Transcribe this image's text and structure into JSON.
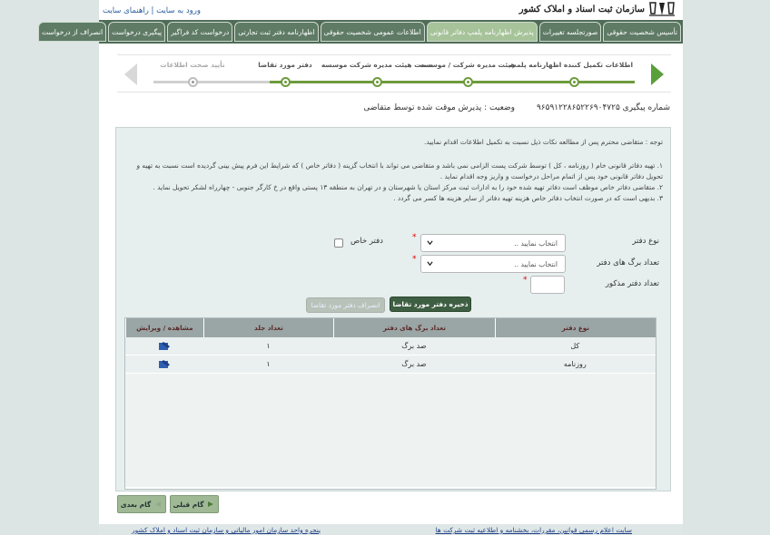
{
  "header": {
    "site_links": [
      "ورود به سایت",
      "راهنمای سایت"
    ],
    "logo_text": "سازمان ثبت اسناد و املاک کشور"
  },
  "tabs": [
    {
      "label": "تأسیس شخصیت حقوقی",
      "active": false
    },
    {
      "label": "صورتجلسه تغییرات",
      "active": false
    },
    {
      "label": "پذیرش اظهارنامه پلمپ دفاتر قانونی",
      "active": true
    },
    {
      "label": "اطلاعات عمومی شخصیت حقوقی",
      "active": false
    },
    {
      "label": "اظهارنامه دفتر ثبت تجارتی",
      "active": false
    },
    {
      "label": "درخواست کد فراگیر",
      "active": false
    },
    {
      "label": "پیگیری درخواست",
      "active": false
    },
    {
      "label": "انصراف از درخواست",
      "active": false
    }
  ],
  "wizard": {
    "steps": [
      {
        "label": "اطلاعات تکمیل کننده اظهارنامه پلمپ",
        "done": true
      },
      {
        "label": "هیئت مدیره شرکت / موسسه",
        "done": true
      },
      {
        "label": "سمت هیئت مدیره شرکت موسسه",
        "done": true
      },
      {
        "label": "دفتر مورد تقاضا",
        "done": true
      },
      {
        "label": "تأیید صحت اطلاعات",
        "done": false
      }
    ]
  },
  "status": {
    "tracking": "شماره پیگیری ۹۶۵۹۱۲۲۸۶۵۲۲۶۹۰۴۷۲۵",
    "state": "وضعیت : پذیرش موقت شده توسط متقاضی"
  },
  "notes": {
    "intro": "توجه : متقاضی محترم پس از مطالعه نکات ذیل نسبت به تکمیل اطلاعات اقدام نمایید.",
    "items": [
      "۱. تهیه دفاتر قانونی خام ( روزنامه ، کل ) توسط شرکت پست الزامی نمی باشد و متقاضی می تواند با انتخاب گزینه ( دفاتر خاص ) که شرایط این فرم پیش بینی گردیده است نسبت به تهیه و تحویل دفاتر قانونی خود پس از اتمام مراحل درخواست و واریز وجه اقدام نماید .",
      "۲. متقاضی دفاتر خاص موظف است دفاتر تهیه شده خود را به ادارات ثبت مرکز استان یا شهرستان و در تهران به منطقه ۱۳ پستی واقع در خ کارگر جنوبی - چهارراه لشکر تحویل نماید .",
      "۳. بدیهی است که در صورت انتخاب دفاتر خاص هزینه تهیه دفاتر از سایر هزینه ها کسر می گردد ."
    ]
  },
  "form": {
    "book_type_label": "نوع دفتر",
    "book_type_value": "انتخاب نمایید ..",
    "special_book_label": "دفتر خاص",
    "pages_label": "تعداد برگ های دفتر",
    "pages_value": "انتخاب نمایید ..",
    "count_label": "تعداد دفتر مذکور",
    "count_value": "",
    "save_button": "ذخیره دفتر مورد تقاضا",
    "cancel_button": "انصراف دفتر مورد تقاضا"
  },
  "table": {
    "headers": [
      "نوع دفتر",
      "تعداد برگ های دفتر",
      "تعداد جلد",
      "مشاهده / ویرایش"
    ],
    "rows": [
      {
        "type": "کل",
        "pages": "صد برگ",
        "count": "۱"
      },
      {
        "type": "روزنامه",
        "pages": "صد برگ",
        "count": "۱"
      }
    ]
  },
  "nav": {
    "prev": "گام قبلی",
    "next": "گام بعدی"
  },
  "footer": {
    "links": [
      "سایت اعلام رسمی قوانین، مقررات، بخشنامه و اطلاعیه ثبت شرکت ها",
      "پنجره واحد سازمان امور مالیاتی و سازمان ثبت اسناد و املاک کشور"
    ]
  },
  "colors": {
    "tabbar": "#4f6c57",
    "active_tab": "#a7c39a",
    "progress": "#6e9b3d",
    "primary_button": "#3f5f43"
  }
}
